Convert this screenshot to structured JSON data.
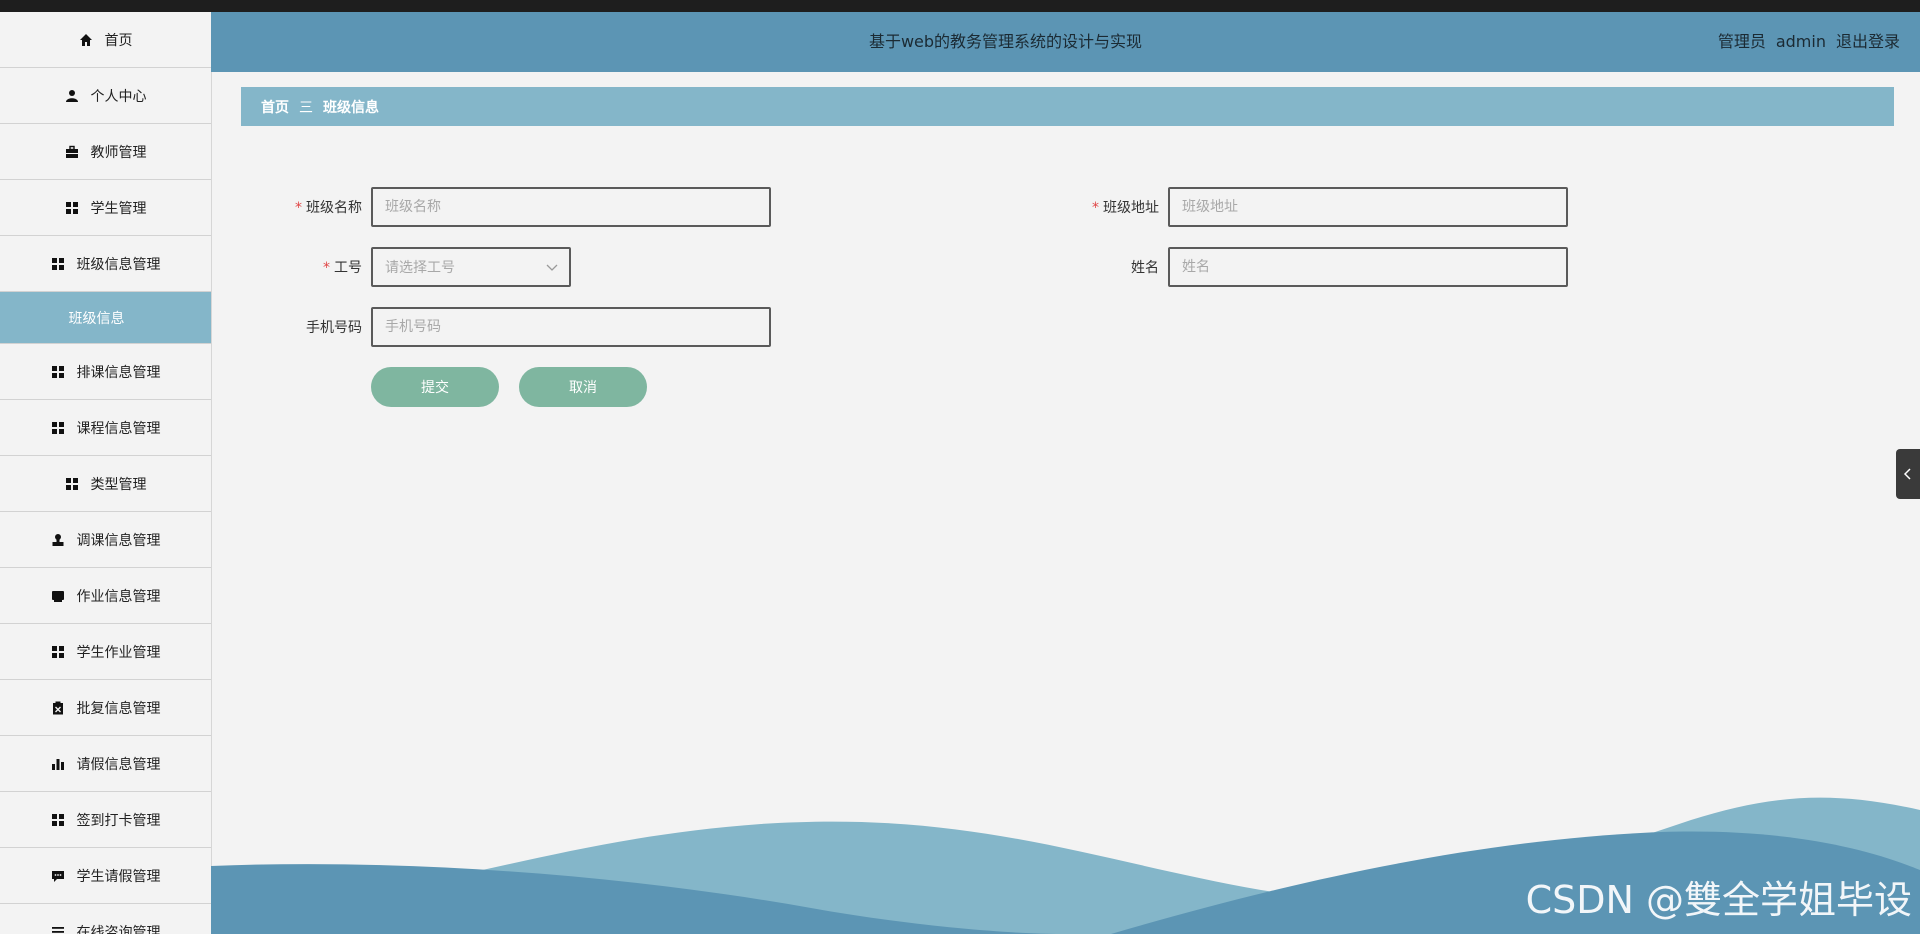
{
  "header": {
    "title": "基于web的教务管理系统的设计与实现",
    "role": "管理员",
    "username": "admin",
    "logout": "退出登录"
  },
  "sidebar": {
    "items": [
      {
        "label": "首页",
        "icon": "home-icon"
      },
      {
        "label": "个人中心",
        "icon": "user-icon"
      },
      {
        "label": "教师管理",
        "icon": "briefcase-icon"
      },
      {
        "label": "学生管理",
        "icon": "grid-icon"
      },
      {
        "label": "班级信息管理",
        "icon": "grid-icon"
      },
      {
        "label": "班级信息",
        "icon": "",
        "active": true
      },
      {
        "label": "排课信息管理",
        "icon": "grid-icon"
      },
      {
        "label": "课程信息管理",
        "icon": "grid-icon"
      },
      {
        "label": "类型管理",
        "icon": "grid-icon"
      },
      {
        "label": "调课信息管理",
        "icon": "stamp-icon"
      },
      {
        "label": "作业信息管理",
        "icon": "tray-icon"
      },
      {
        "label": "学生作业管理",
        "icon": "grid-icon"
      },
      {
        "label": "批复信息管理",
        "icon": "clipboard-x-icon"
      },
      {
        "label": "请假信息管理",
        "icon": "bar-chart-icon"
      },
      {
        "label": "签到打卡管理",
        "icon": "grid-icon"
      },
      {
        "label": "学生请假管理",
        "icon": "chat-icon"
      },
      {
        "label": "在线咨询管理",
        "icon": "list-icon"
      }
    ]
  },
  "breadcrumb": {
    "home": "首页",
    "separator": "三",
    "current": "班级信息"
  },
  "form": {
    "class_name_label": "班级名称",
    "class_name_placeholder": "班级名称",
    "class_address_label": "班级地址",
    "class_address_placeholder": "班级地址",
    "job_no_label": "工号",
    "job_no_placeholder": "请选择工号",
    "name_label": "姓名",
    "name_placeholder": "姓名",
    "phone_label": "手机号码",
    "phone_placeholder": "手机号码",
    "required_mark": "*",
    "submit": "提交",
    "cancel": "取消"
  },
  "watermark": "CSDN @雙全学姐毕设",
  "colors": {
    "header": "#5c95b4",
    "accent": "#84b6c9",
    "button": "#7fb6a0",
    "required": "#e04545"
  }
}
